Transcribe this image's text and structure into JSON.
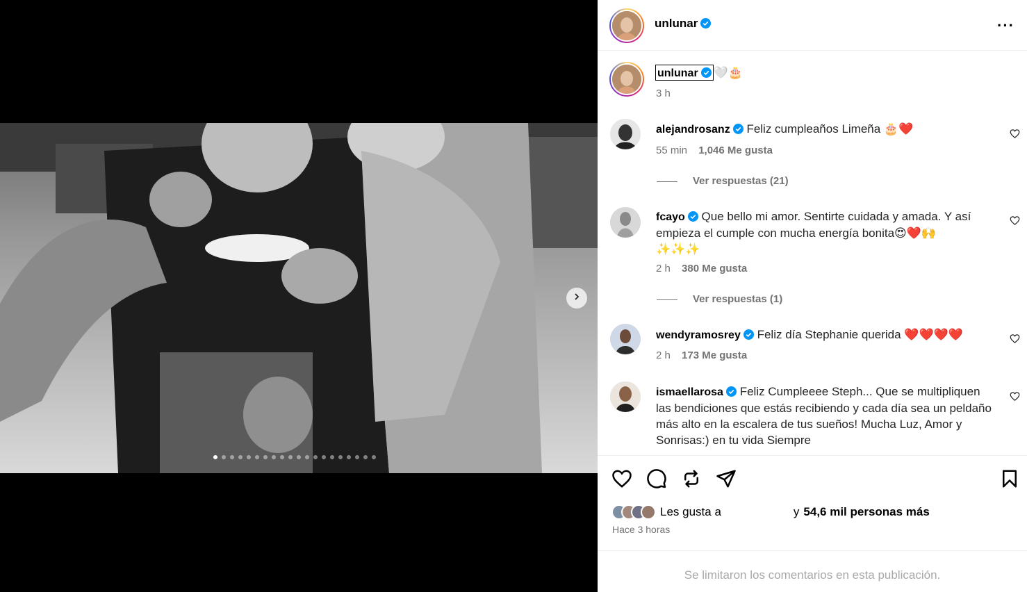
{
  "post": {
    "author": "unlunar",
    "more_label": "···"
  },
  "caption": {
    "username": "unlunar",
    "text": "🤍🎂",
    "time": "3 h"
  },
  "comments": [
    {
      "username": "alejandrosanz",
      "text": "Feliz cumpleaños Limeña 🎂❤️",
      "time": "55 min",
      "likes": "1,046 Me gusta",
      "replies": "Ver respuestas (21)"
    },
    {
      "username": "fcayo",
      "text_line1": "Que bello mi amor. Sentirte cuidada y amada. Y así",
      "text_line2": "empieza el cumple con mucha energía bonita😍❤️🙌",
      "text_line3": "✨✨✨",
      "time": "2 h",
      "likes": "380 Me gusta",
      "replies": "Ver respuestas (1)"
    },
    {
      "username": "wendyramosrey",
      "text": "Feliz día Stephanie querida ❤️❤️❤️❤️",
      "time": "2 h",
      "likes": "173 Me gusta"
    },
    {
      "username": "ismaellarosa",
      "text_line1": "Feliz Cumpleeee Steph... Que se multipliquen",
      "text_line2": "las bendiciones que estás recibiendo y cada día sea un peldaño",
      "text_line3": "más alto en la escalera de tus sueños! Mucha Luz, Amor y",
      "text_line4": "Sonrisas:) en tu vida Siempre"
    }
  ],
  "likes_summary": {
    "prefix": "Les gusta a",
    "middle": "y",
    "count": "54,6 mil personas más",
    "time": "Hace 3 horas"
  },
  "footer": {
    "limited": "Se limitaron los comentarios en esta publicación."
  },
  "carousel": {
    "total": 20,
    "current": 1
  },
  "colors": {
    "verified": "#0095f6",
    "heart": "#ff3040",
    "muted": "#737373"
  },
  "icons": [
    "more-icon",
    "verified-icon",
    "heart-icon",
    "comment-icon",
    "repost-icon",
    "share-icon",
    "bookmark-icon",
    "chevron-right-icon"
  ]
}
